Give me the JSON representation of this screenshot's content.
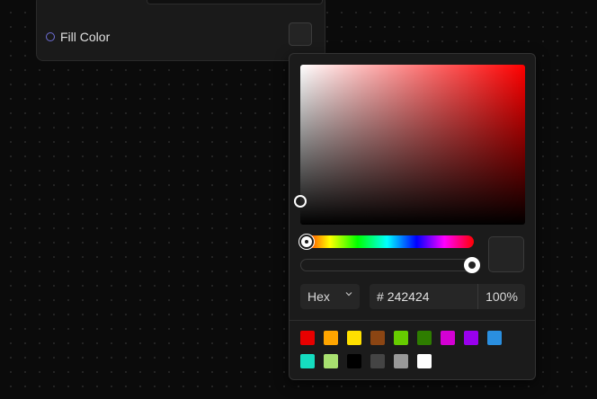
{
  "node": {
    "field_label": "Fill Color",
    "field_value": "#242424"
  },
  "picker": {
    "hue_percent": 0,
    "alpha_percent": 100,
    "format": "Hex",
    "hash": "#",
    "hex": "242424",
    "alpha": "100%",
    "presets": [
      {
        "color": "#e80000"
      },
      {
        "color": "#ffa500"
      },
      {
        "color": "#ffe000"
      },
      {
        "color": "#8b4513"
      },
      {
        "color": "#66cc00"
      },
      {
        "color": "#2e7d00"
      },
      {
        "color": "#d400d4"
      },
      {
        "color": "#9900ee"
      },
      {
        "color": "#2a8fe0"
      },
      {
        "color": "#15ddc0"
      },
      {
        "color": "#a8e070"
      },
      {
        "color": "#000000"
      },
      {
        "color": "#444444"
      },
      {
        "color": "#999999"
      },
      {
        "color": "#ffffff"
      }
    ]
  }
}
